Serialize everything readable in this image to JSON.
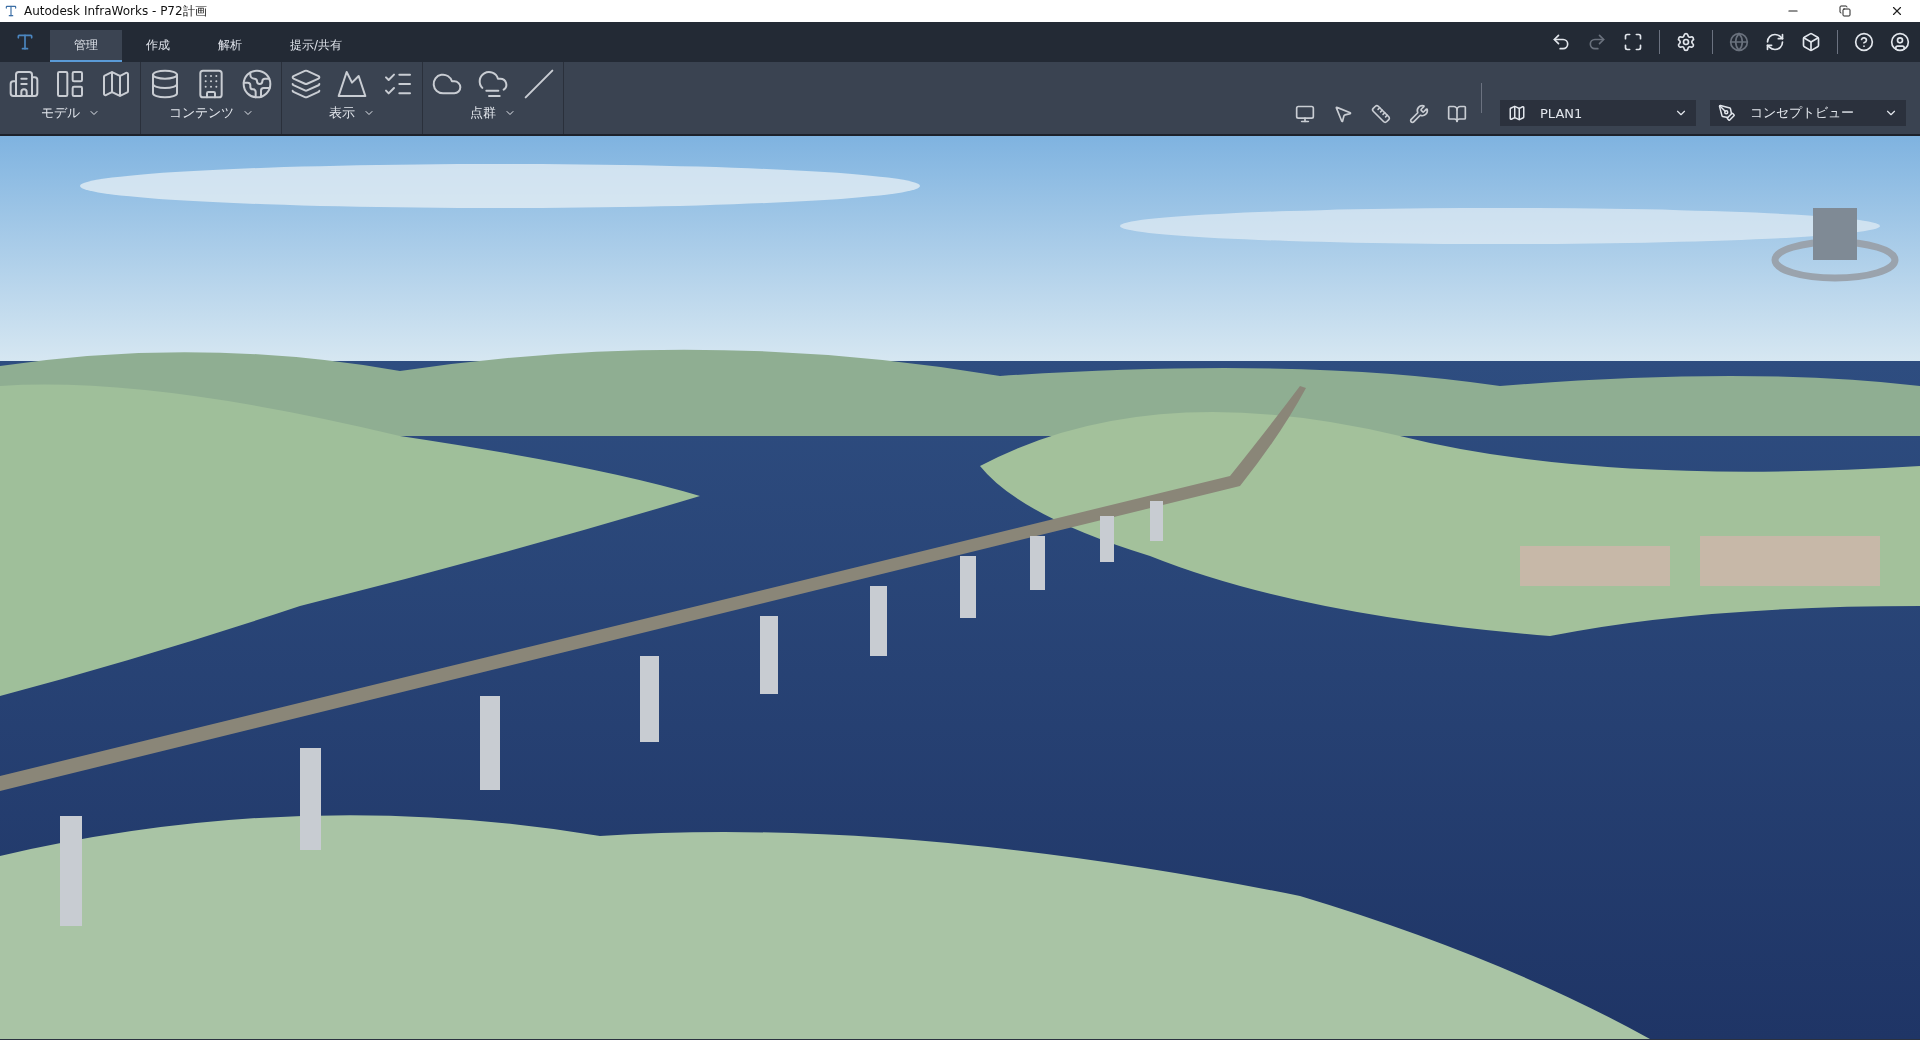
{
  "window": {
    "title": "Autodesk InfraWorks - P72計画"
  },
  "tabs": [
    {
      "label": "管理",
      "selected": true
    },
    {
      "label": "作成",
      "selected": false
    },
    {
      "label": "解析",
      "selected": false
    },
    {
      "label": "提示/共有",
      "selected": false
    }
  ],
  "quick_access": [
    {
      "kind": "undo",
      "disabled": false
    },
    {
      "kind": "redo",
      "disabled": true
    },
    {
      "kind": "fit",
      "disabled": false
    },
    {
      "kind": "sep"
    },
    {
      "kind": "settings",
      "disabled": false
    },
    {
      "kind": "sep"
    },
    {
      "kind": "globe",
      "disabled": true
    },
    {
      "kind": "sync",
      "disabled": false
    },
    {
      "kind": "share",
      "disabled": false
    },
    {
      "kind": "sep"
    },
    {
      "kind": "help",
      "disabled": false
    },
    {
      "kind": "user",
      "disabled": false
    }
  ],
  "ribbon_groups": [
    {
      "label": "モデル"
    },
    {
      "label": "コンテンツ"
    },
    {
      "label": "表示"
    },
    {
      "label": "点群"
    }
  ],
  "view_selectors": [
    {
      "kind": "plan",
      "value": "PLAN1"
    },
    {
      "kind": "style",
      "value": "コンセプトビュー"
    }
  ]
}
